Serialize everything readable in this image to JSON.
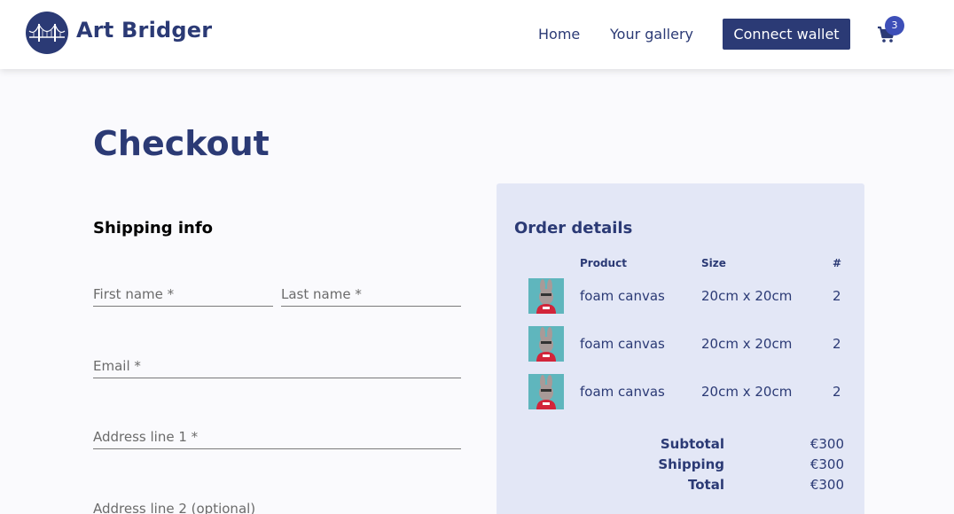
{
  "header": {
    "brand": "Art Bridger",
    "nav": {
      "home": "Home",
      "gallery": "Your gallery"
    },
    "wallet_button": "Connect wallet",
    "cart_count": "3",
    "cart_icon": "shopping-cart-icon",
    "logo_icon": "bridge-logo-icon"
  },
  "page": {
    "title": "Checkout"
  },
  "shipping": {
    "title": "Shipping info",
    "first_name": {
      "placeholder": "First name *",
      "value": ""
    },
    "last_name": {
      "placeholder": "Last name *",
      "value": ""
    },
    "email": {
      "placeholder": "Email *",
      "value": ""
    },
    "address1": {
      "placeholder": "Address line 1 *",
      "value": ""
    },
    "address2": {
      "placeholder": "Address line 2 (optional)",
      "value": ""
    }
  },
  "order": {
    "title": "Order details",
    "columns": {
      "product": "Product",
      "size": "Size",
      "count": "#"
    },
    "items": [
      {
        "product": "foam canvas",
        "size": "20cm x 20cm",
        "count": "2"
      },
      {
        "product": "foam canvas",
        "size": "20cm x 20cm",
        "count": "2"
      },
      {
        "product": "foam canvas",
        "size": "20cm x 20cm",
        "count": "2"
      }
    ],
    "subtotal_label": "Subtotal",
    "subtotal_value": "€300",
    "shipping_label": "Shipping",
    "shipping_value": "€300",
    "total_label": "Total",
    "total_value": "€300"
  },
  "colors": {
    "brand": "#2b3a75",
    "badge": "#3d4fb8",
    "panel": "#e3e7f6",
    "background": "#fafafd"
  }
}
